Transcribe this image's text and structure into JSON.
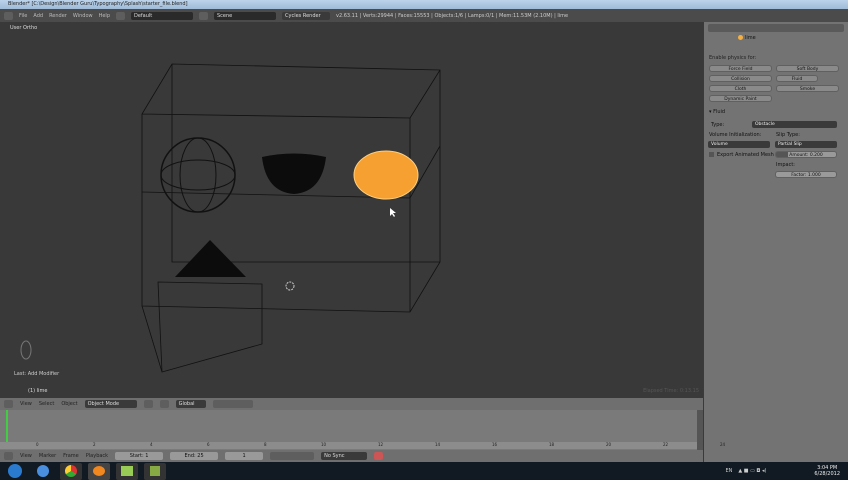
{
  "window": {
    "title": "Blender* [C:\\Design\\Blender Guru\\Typography\\Splash\\starter_file.blend]"
  },
  "topbar": {
    "menus": [
      "File",
      "Add",
      "Render",
      "Window",
      "Help"
    ],
    "layout": "Default",
    "scene": "Scene",
    "engine": "Cycles Render",
    "stats": "v2.63.11 | Verts:29944 | Faces:15553 | Objects:1/6 | Lamps:0/1 | Mem:11.53M (2.10M) | lime"
  },
  "viewport": {
    "view_label": "User Ortho",
    "last_op": "Last: Add Modifier",
    "object_label": "(1) lime",
    "render_time": "Elapsed Time: 0:13.15"
  },
  "panel": {
    "object": "lime",
    "enable_label": "Enable physics for:",
    "buttons": [
      "Force Field",
      "Soft Body",
      "Collision",
      "Fluid",
      "Cloth",
      "Smoke",
      "Dynamic Paint"
    ],
    "section": "Fluid",
    "type_label": "Type:",
    "type_value": "Obstacle",
    "volume_label": "Volume Initialization:",
    "volume_value": "Volume",
    "slip_label": "Slip Type:",
    "slip_value": "Partial Slip",
    "export_label": "Export Animated Mesh",
    "amount": "Amount: 0.200",
    "impact_label": "Impact:",
    "factor": "Factor: 1.000"
  },
  "view3d_header": {
    "menus": [
      "View",
      "Select",
      "Object"
    ],
    "mode": "Object Mode",
    "orientation": "Global"
  },
  "timeline": {
    "ticks": [
      "0",
      "2",
      "4",
      "6",
      "8",
      "10",
      "12",
      "14",
      "16",
      "18",
      "20",
      "22",
      "24"
    ],
    "menus": [
      "View",
      "Marker",
      "Frame",
      "Playback"
    ],
    "start": "Start: 1",
    "end": "End: 25",
    "current": "1",
    "sync": "No Sync"
  },
  "taskbar": {
    "lang": "EN",
    "time": "3:04 PM",
    "date": "6/28/2012"
  },
  "colors": {
    "selected": "#f5a030",
    "panel": "#737373",
    "viewport": "#393939"
  }
}
